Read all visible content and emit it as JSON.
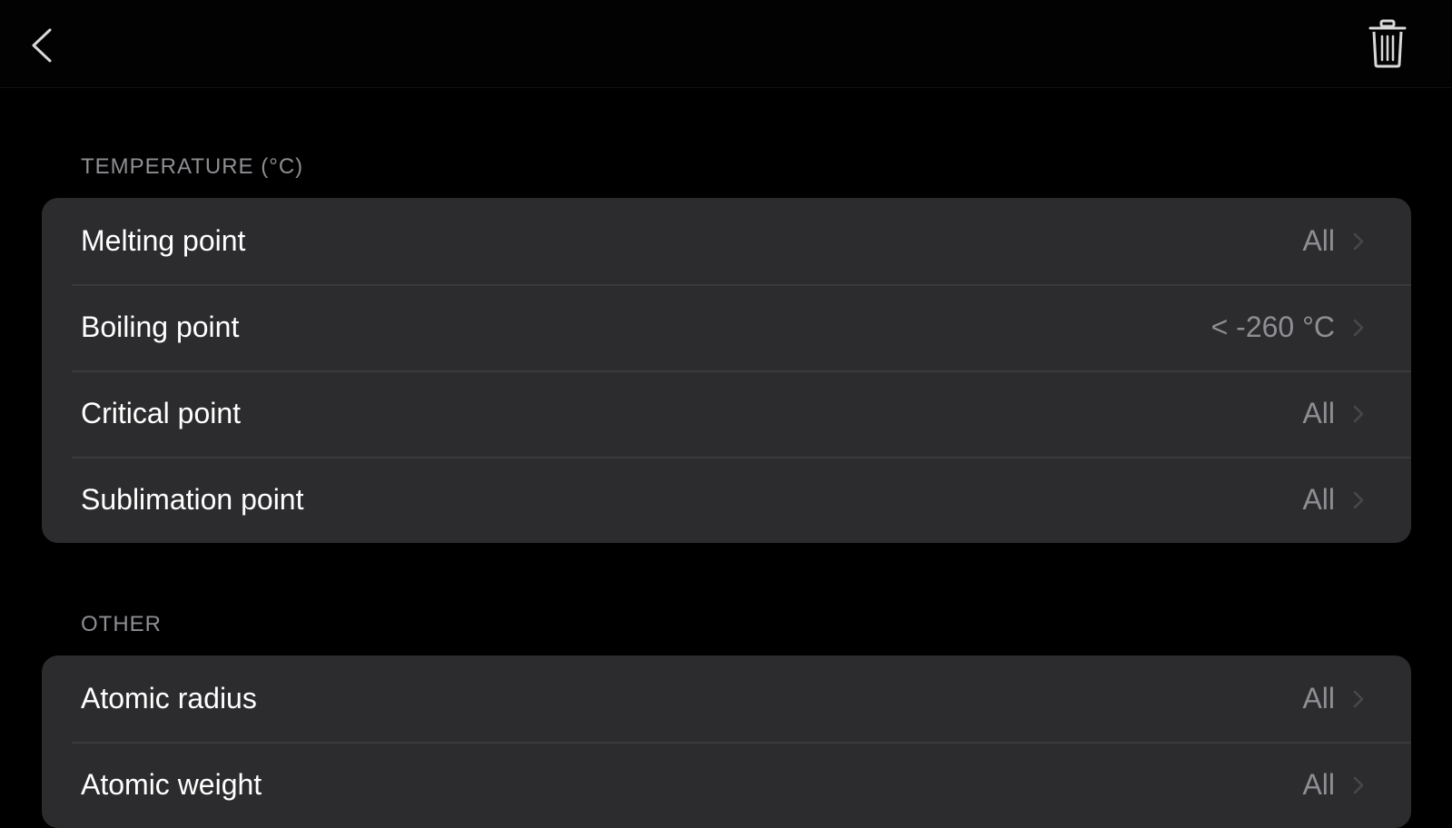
{
  "nav": {
    "back_icon": "chevron-left-icon",
    "trash_icon": "trash-icon"
  },
  "sections": [
    {
      "header": "TEMPERATURE (°C)",
      "rows": [
        {
          "label": "Melting point",
          "value": "All"
        },
        {
          "label": "Boiling point",
          "value": "< -260 °C"
        },
        {
          "label": "Critical point",
          "value": "All"
        },
        {
          "label": "Sublimation point",
          "value": "All"
        }
      ]
    },
    {
      "header": "OTHER",
      "rows": [
        {
          "label": "Atomic radius",
          "value": "All"
        },
        {
          "label": "Atomic weight",
          "value": "All"
        }
      ]
    }
  ],
  "colors": {
    "background": "#000000",
    "cell": "#2c2c2e",
    "separator": "#3a3a3c",
    "secondary_text": "#8e8e93",
    "accent": "#ffffff"
  }
}
